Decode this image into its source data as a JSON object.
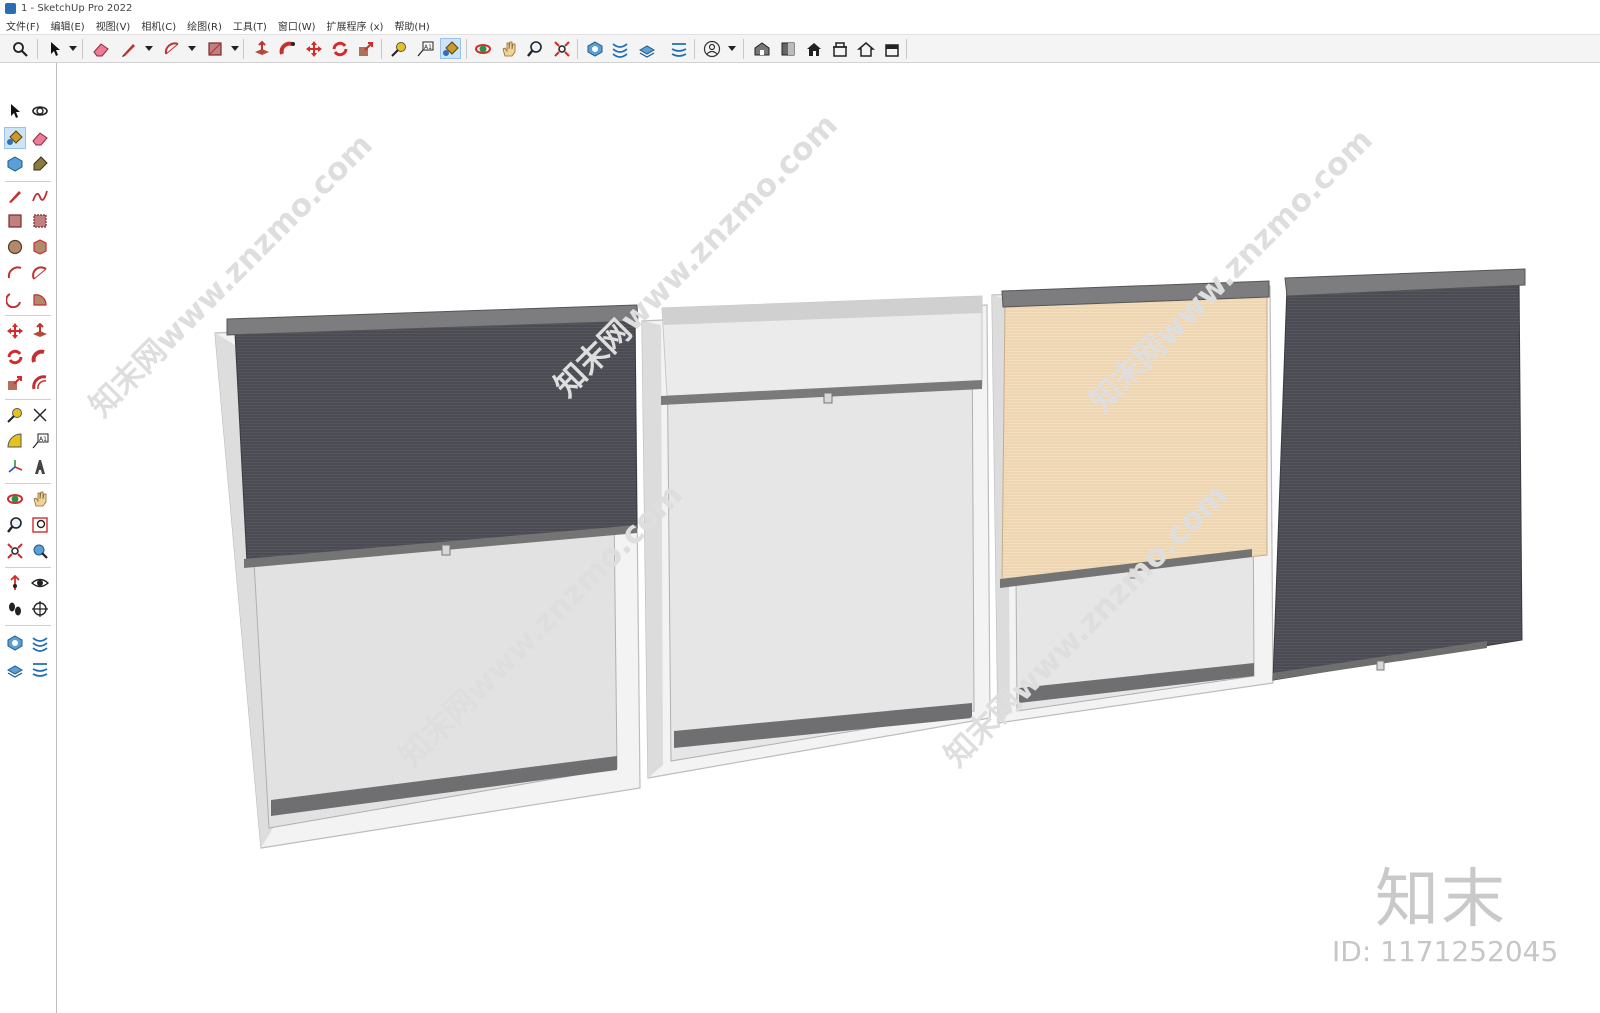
{
  "window": {
    "title": "1 - SketchUp Pro 2022"
  },
  "menu": [
    {
      "label": "文件(F)"
    },
    {
      "label": "编辑(E)"
    },
    {
      "label": "视图(V)"
    },
    {
      "label": "相机(C)"
    },
    {
      "label": "绘图(R)"
    },
    {
      "label": "工具(T)"
    },
    {
      "label": "窗口(W)"
    },
    {
      "label": "扩展程序 (x)"
    },
    {
      "label": "帮助(H)"
    }
  ],
  "toolbar": {
    "icons": [
      "search-icon",
      "select-icon",
      "eraser-icon",
      "pencil-icon",
      "arc-icon",
      "rectangle-icon",
      "push-pull-icon",
      "follow-me-icon",
      "move-icon",
      "rotate-icon",
      "scale-icon",
      "tape-measure-icon",
      "text-label-icon",
      "paint-bucket-icon",
      "orbit-icon",
      "pan-icon",
      "zoom-icon",
      "zoom-extents-icon",
      "sandbox-icon",
      "smoove-icon",
      "stamp-icon",
      "drape-icon",
      "user-icon",
      "warehouse-icon",
      "component-icon",
      "house-icon",
      "house-outline-icon",
      "section-icon"
    ],
    "active": "paint-bucket-icon"
  },
  "left_toolbar": {
    "active": "paint-bucket-icon"
  },
  "viewport": {
    "watermark": "知末网www.znzmo.com",
    "brand_logo": "知末",
    "brand_id": "ID: 1171252045"
  },
  "colors": {
    "accent": "#2a6db5",
    "active_bg": "#cde4f7",
    "blind_dark": "#4a4b52",
    "blind_light": "#ebebeb",
    "blind_beige": "#eed7b4",
    "frame": "#f2f2f2"
  }
}
